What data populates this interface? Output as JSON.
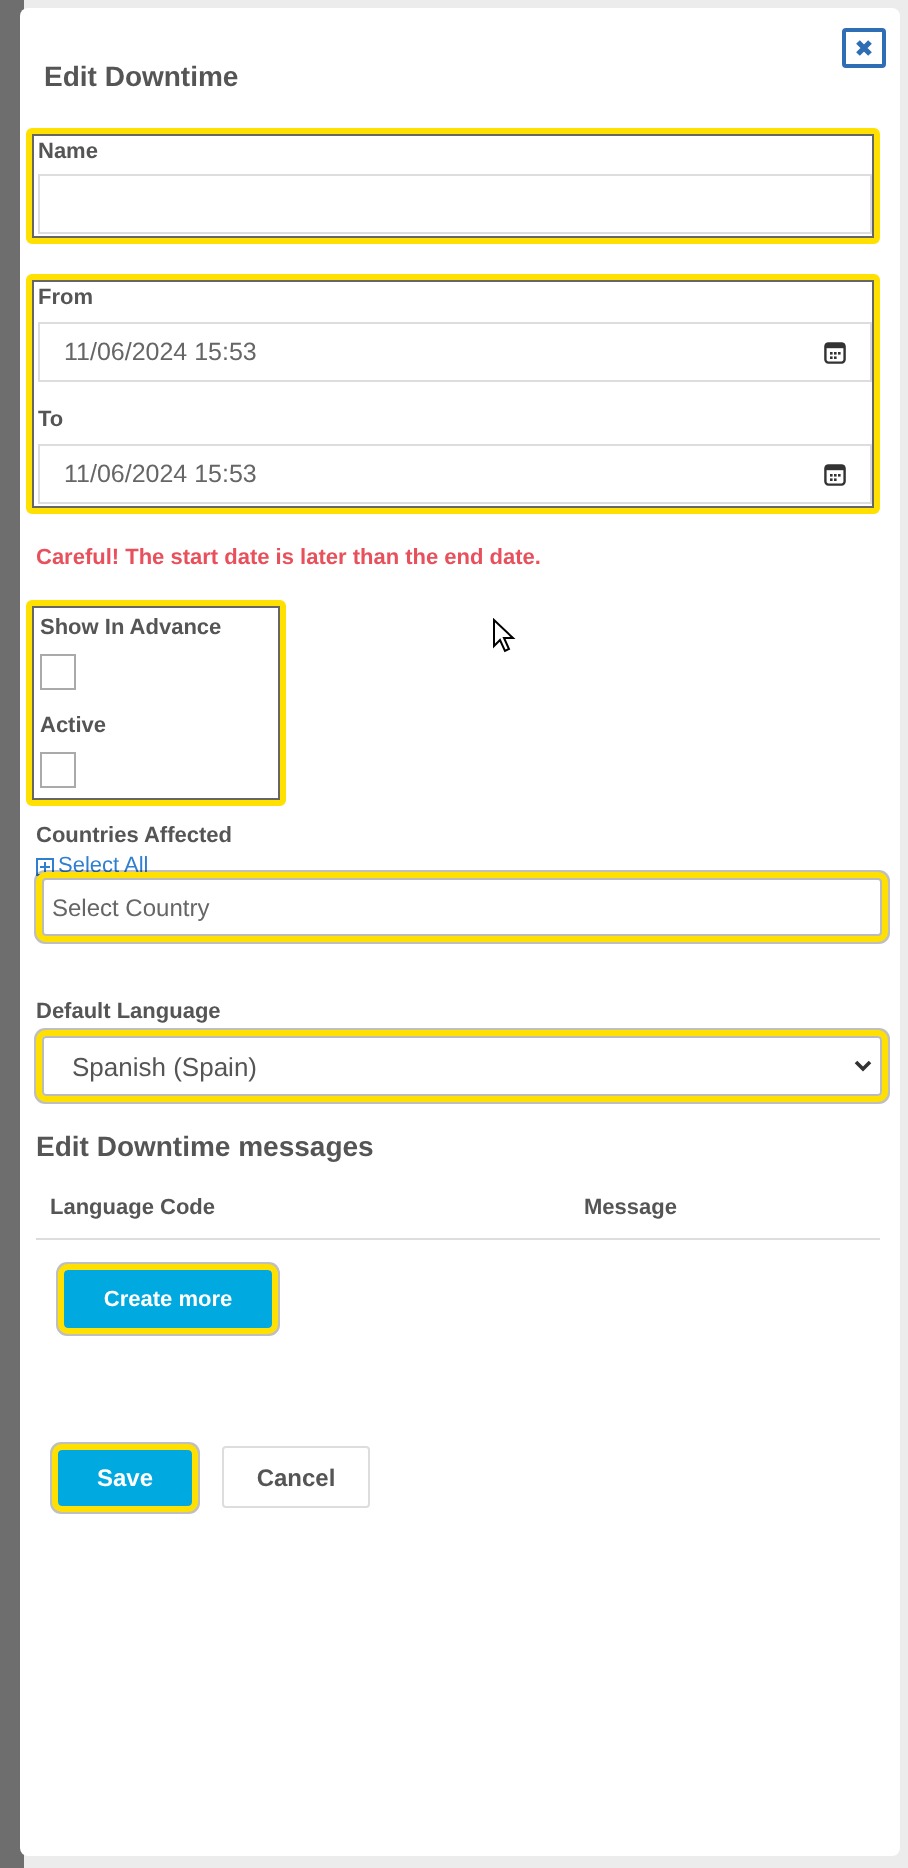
{
  "dialog": {
    "title": "Edit Downtime"
  },
  "name_group": {
    "highlighted": true,
    "label": "Name"
  },
  "dates_group": {
    "highlighted": true,
    "fields": [
      {
        "label": "From",
        "value": "11/06/2024 15:53"
      },
      {
        "label": "To",
        "value": "11/06/2024 15:53"
      }
    ]
  },
  "error": "Careful! The start date is later than the end date.",
  "checkbox_group": {
    "highlighted": true,
    "items": [
      {
        "label": "Show In Advance",
        "checked": false
      },
      {
        "label": "Active",
        "checked": false
      }
    ]
  },
  "countries": {
    "label": "Countries Affected",
    "select_all": "Select All",
    "placeholder": "Select Country",
    "highlighted": true
  },
  "default_language": {
    "label": "Default Language",
    "value": "Spanish (Spain)",
    "highlighted": true
  },
  "messages": {
    "title": "Edit Downtime messages",
    "columns": [
      "Language Code",
      "Message"
    ],
    "create_button": {
      "label": "Create more",
      "highlighted": true
    }
  },
  "buttons": [
    {
      "label": "Save",
      "kind": "primary",
      "highlighted": true
    },
    {
      "label": "Cancel",
      "kind": "secondary",
      "highlighted": false
    }
  ]
}
